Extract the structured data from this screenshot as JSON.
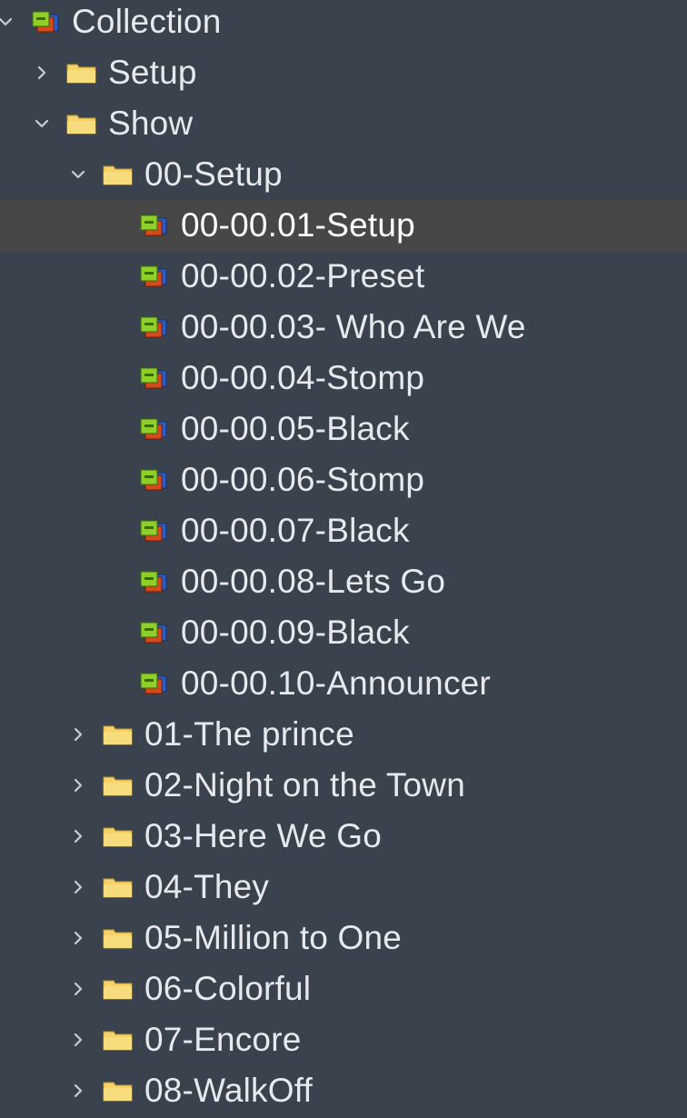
{
  "tree": {
    "root": {
      "label": "Collection",
      "icon": "collection-icon",
      "expanded": true
    },
    "setup": {
      "label": "Setup",
      "icon": "folder-icon",
      "expanded": false
    },
    "show": {
      "label": "Show",
      "icon": "folder-icon",
      "expanded": true
    },
    "setup_group": {
      "label": "00-Setup",
      "icon": "folder-icon",
      "expanded": true
    },
    "cues": [
      {
        "label": "00-00.01-Setup",
        "icon": "cue-icon",
        "selected": true
      },
      {
        "label": "00-00.02-Preset",
        "icon": "cue-icon"
      },
      {
        "label": "00-00.03- Who Are We",
        "icon": "cue-icon"
      },
      {
        "label": "00-00.04-Stomp",
        "icon": "cue-icon"
      },
      {
        "label": "00-00.05-Black",
        "icon": "cue-icon"
      },
      {
        "label": "00-00.06-Stomp",
        "icon": "cue-icon"
      },
      {
        "label": "00-00.07-Black",
        "icon": "cue-icon"
      },
      {
        "label": "00-00.08-Lets Go",
        "icon": "cue-icon"
      },
      {
        "label": "00-00.09-Black",
        "icon": "cue-icon"
      },
      {
        "label": "00-00.10-Announcer",
        "icon": "cue-icon"
      }
    ],
    "folders": [
      {
        "label": "01-The prince",
        "icon": "folder-icon",
        "expanded": false
      },
      {
        "label": "02-Night on the Town",
        "icon": "folder-icon",
        "expanded": false
      },
      {
        "label": "03-Here We Go",
        "icon": "folder-icon",
        "expanded": false
      },
      {
        "label": "04-They",
        "icon": "folder-icon",
        "expanded": false
      },
      {
        "label": "05-Million to One",
        "icon": "folder-icon",
        "expanded": false
      },
      {
        "label": "06-Colorful",
        "icon": "folder-icon",
        "expanded": false
      },
      {
        "label": "07-Encore",
        "icon": "folder-icon",
        "expanded": false
      },
      {
        "label": "08-WalkOff",
        "icon": "folder-icon",
        "expanded": false
      }
    ]
  },
  "colors": {
    "background": "#3a424d",
    "selected_row": "#474747",
    "text": "#e6e9ed",
    "folder": "#f5d36a"
  }
}
